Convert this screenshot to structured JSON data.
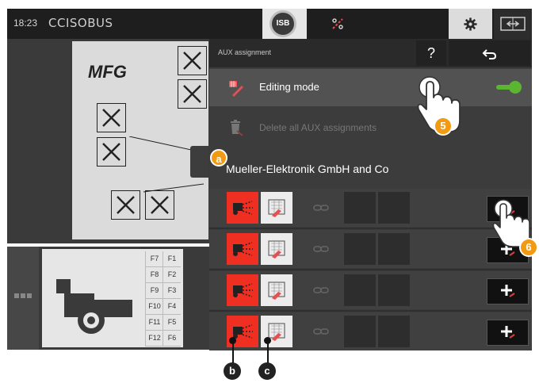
{
  "topbar": {
    "time": "18:23",
    "brand": "CCISOBUS",
    "isb_label": "ISB",
    "icons": {
      "isb": "isb-icon",
      "tool": "tool-icon",
      "settings": "gear-icon",
      "swap": "swap-screen-icon"
    }
  },
  "mask": {
    "logo_text": "MFG",
    "fkeys": [
      "F7",
      "F1",
      "F8",
      "F2",
      "F9",
      "F3",
      "F10",
      "F4",
      "F11",
      "F5",
      "F12",
      "F6"
    ]
  },
  "panel": {
    "title": "AUX assignment",
    "help_label": "?",
    "back_icon": "undo-icon",
    "editing_mode": {
      "label": "Editing mode",
      "enabled": true,
      "icon": "edit-icon"
    },
    "delete_all": {
      "label": "Delete all AUX assignments",
      "enabled": false,
      "icon": "trash-icon"
    },
    "company": "Mueller-Elektronik GmbH and Co",
    "rows": [
      {
        "function_icon": "sprayer-function-icon",
        "input_icon": "aux-input-icon",
        "link_icon": "chain-link-icon"
      },
      {
        "function_icon": "sprayer-function-icon",
        "input_icon": "aux-input-icon",
        "link_icon": "chain-link-icon"
      },
      {
        "function_icon": "sprayer-function-icon",
        "input_icon": "aux-input-icon",
        "link_icon": "chain-link-icon"
      },
      {
        "function_icon": "sprayer-function-icon",
        "input_icon": "aux-input-icon",
        "link_icon": "chain-link-icon"
      }
    ]
  },
  "callouts": {
    "a": "a",
    "b": "b",
    "c": "c",
    "five": "5",
    "six": "6"
  },
  "colors": {
    "accent_green": "#5cb531",
    "function_red": "#ef2f22",
    "callout_orange": "#f29a12"
  }
}
